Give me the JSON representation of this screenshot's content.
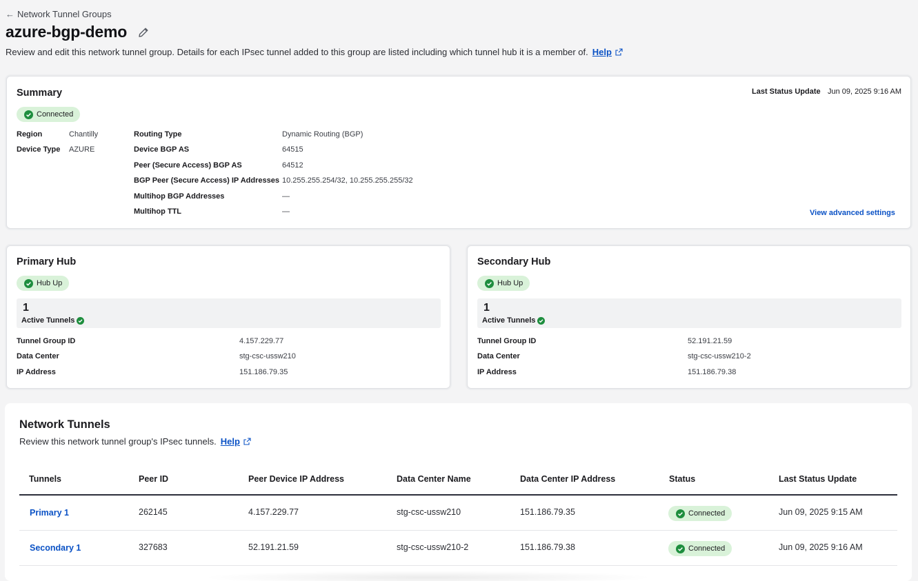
{
  "breadcrumb": {
    "back_label": "Network Tunnel Groups"
  },
  "page": {
    "title": "azure-bgp-demo",
    "description": "Review and edit this network tunnel group. Details for each IPsec tunnel added to this group are listed including which tunnel hub it is a member of.",
    "help_label": "Help"
  },
  "summary": {
    "title": "Summary",
    "status": "Connected",
    "last_status_label": "Last Status Update",
    "last_status_value": "Jun 09, 2025 9:16 AM",
    "region_label": "Region",
    "region_value": "Chantilly",
    "device_type_label": "Device Type",
    "device_type_value": "AZURE",
    "routing_type_label": "Routing Type",
    "routing_type_value": "Dynamic Routing (BGP)",
    "device_bgp_as_label": "Device BGP AS",
    "device_bgp_as_value": "64515",
    "peer_bgp_as_label": "Peer (Secure Access) BGP AS",
    "peer_bgp_as_value": "64512",
    "bgp_peer_ips_label": "BGP Peer (Secure Access) IP Addresses",
    "bgp_peer_ips_value": "10.255.255.254/32, 10.255.255.255/32",
    "multihop_addresses_label": "Multihop BGP Addresses",
    "multihop_addresses_value": "—",
    "multihop_ttl_label": "Multihop TTL",
    "multihop_ttl_value": "—",
    "advanced_link": "View advanced settings"
  },
  "primary_hub": {
    "title": "Primary Hub",
    "status": "Hub Up",
    "active_count": "1",
    "active_label": "Active Tunnels",
    "tunnel_group_id_label": "Tunnel Group ID",
    "tunnel_group_id_value": "4.157.229.77",
    "data_center_label": "Data Center",
    "data_center_value": "stg-csc-ussw210",
    "ip_address_label": "IP Address",
    "ip_address_value": "151.186.79.35"
  },
  "secondary_hub": {
    "title": "Secondary Hub",
    "status": "Hub Up",
    "active_count": "1",
    "active_label": "Active Tunnels",
    "tunnel_group_id_label": "Tunnel Group ID",
    "tunnel_group_id_value": "52.191.21.59",
    "data_center_label": "Data Center",
    "data_center_value": "stg-csc-ussw210-2",
    "ip_address_label": "IP Address",
    "ip_address_value": "151.186.79.38"
  },
  "network_tunnels": {
    "title": "Network Tunnels",
    "description": "Review this network tunnel group's IPsec tunnels.",
    "help_label": "Help",
    "columns": [
      "Tunnels",
      "Peer ID",
      "Peer Device IP Address",
      "Data Center Name",
      "Data Center IP Address",
      "Status",
      "Last Status Update"
    ],
    "rows": [
      {
        "tunnel": "Primary 1",
        "peer_id": "262145",
        "peer_ip": "4.157.229.77",
        "dc_name": "stg-csc-ussw210",
        "dc_ip": "151.186.79.35",
        "status": "Connected",
        "last_update": "Jun 09, 2025 9:15 AM"
      },
      {
        "tunnel": "Secondary 1",
        "peer_id": "327683",
        "peer_ip": "52.191.21.59",
        "dc_name": "stg-csc-ussw210-2",
        "dc_ip": "151.186.79.38",
        "status": "Connected",
        "last_update": "Jun 09, 2025 9:16 AM"
      }
    ]
  },
  "colors": {
    "link": "#0b52c5",
    "success_bg": "#d9f2d9",
    "success_icon": "#1e8e3e"
  }
}
